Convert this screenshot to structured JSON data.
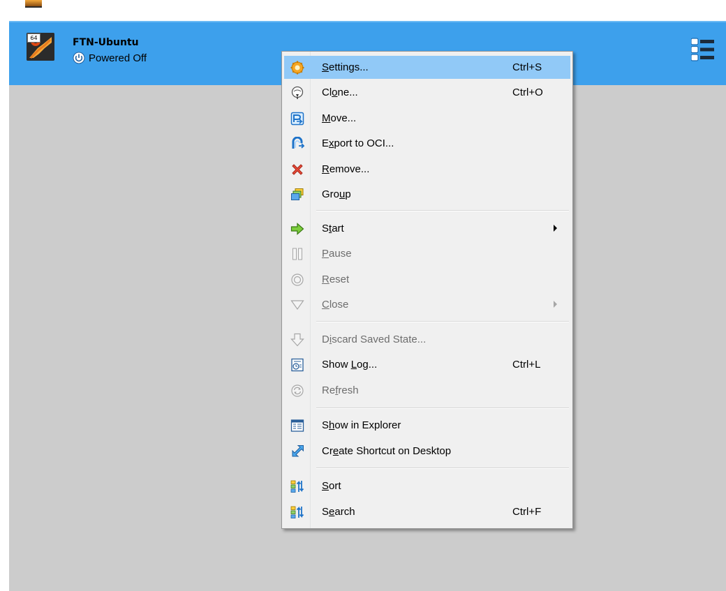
{
  "vm": {
    "os_badge": "64",
    "name": "FTN-Ubuntu",
    "state": "Powered Off"
  },
  "menu": {
    "items": [
      {
        "pre": "",
        "mn": "S",
        "post": "ettings...",
        "shortcut": "Ctrl+S",
        "icon": "settings-gear-icon",
        "selected": true,
        "disabled": false
      },
      {
        "pre": "Cl",
        "mn": "o",
        "post": "ne...",
        "shortcut": "Ctrl+O",
        "icon": "clone-sheep-icon",
        "selected": false,
        "disabled": false
      },
      {
        "pre": "",
        "mn": "M",
        "post": "ove...",
        "shortcut": "",
        "icon": "move-icon",
        "selected": false,
        "disabled": false
      },
      {
        "pre": "E",
        "mn": "x",
        "post": "port to OCI...",
        "shortcut": "",
        "icon": "export-cloud-icon",
        "selected": false,
        "disabled": false
      },
      {
        "pre": "",
        "mn": "R",
        "post": "emove...",
        "shortcut": "",
        "icon": "remove-x-icon",
        "selected": false,
        "disabled": false
      },
      {
        "pre": "Gro",
        "mn": "u",
        "post": "p",
        "shortcut": "",
        "icon": "group-icon",
        "selected": false,
        "disabled": false
      },
      {
        "pre": "S",
        "mn": "t",
        "post": "art",
        "shortcut": "",
        "icon": "start-arrow-icon",
        "selected": false,
        "disabled": false
      },
      {
        "pre": "",
        "mn": "P",
        "post": "ause",
        "shortcut": "",
        "icon": "pause-icon",
        "selected": false,
        "disabled": true
      },
      {
        "pre": "",
        "mn": "R",
        "post": "eset",
        "shortcut": "",
        "icon": "reset-icon",
        "selected": false,
        "disabled": true
      },
      {
        "pre": "",
        "mn": "C",
        "post": "lose",
        "shortcut": "",
        "icon": "close-triangle-icon",
        "selected": false,
        "disabled": true
      },
      {
        "pre": "D",
        "mn": "i",
        "post": "scard Saved State...",
        "shortcut": "",
        "icon": "discard-state-icon",
        "selected": false,
        "disabled": true
      },
      {
        "pre": "Show ",
        "mn": "L",
        "post": "og...",
        "shortcut": "Ctrl+L",
        "icon": "show-log-icon",
        "selected": false,
        "disabled": false
      },
      {
        "pre": "Re",
        "mn": "f",
        "post": "resh",
        "shortcut": "",
        "icon": "refresh-icon",
        "selected": false,
        "disabled": true
      },
      {
        "pre": "S",
        "mn": "h",
        "post": "ow in Explorer",
        "shortcut": "",
        "icon": "show-in-explorer-icon",
        "selected": false,
        "disabled": false
      },
      {
        "pre": "Cr",
        "mn": "e",
        "post": "ate Shortcut on Desktop",
        "shortcut": "",
        "icon": "create-shortcut-icon",
        "selected": false,
        "disabled": false
      },
      {
        "pre": "",
        "mn": "S",
        "post": "ort",
        "shortcut": "",
        "icon": "sort-icon",
        "selected": false,
        "disabled": false
      },
      {
        "pre": "S",
        "mn": "e",
        "post": "arch",
        "shortcut": "Ctrl+F",
        "icon": "search-sort-icon",
        "selected": false,
        "disabled": false
      }
    ]
  }
}
